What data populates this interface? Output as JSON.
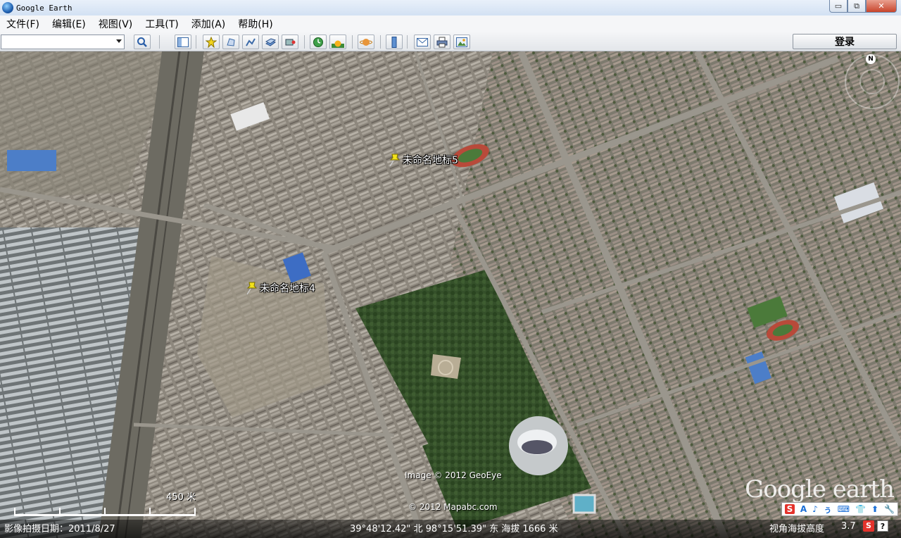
{
  "window": {
    "title": "Google Earth",
    "minimize_glyph": "▭",
    "restore_glyph": "⧉",
    "close_glyph": "✕"
  },
  "menu": {
    "items": [
      {
        "label": "文件(F)"
      },
      {
        "label": "编辑(E)"
      },
      {
        "label": "视图(V)"
      },
      {
        "label": "工具(T)"
      },
      {
        "label": "添加(A)"
      },
      {
        "label": "帮助(H)"
      }
    ]
  },
  "toolbar": {
    "search_value": "",
    "login_label": "登录",
    "buttons": [
      {
        "name": "search-button",
        "icon": "magnifier-icon"
      },
      {
        "name": "sidebar-toggle-button",
        "icon": "sidebar-icon"
      },
      {
        "name": "add-placemark-button",
        "icon": "pushpin-icon"
      },
      {
        "name": "add-polygon-button",
        "icon": "polygon-icon"
      },
      {
        "name": "add-path-button",
        "icon": "path-icon"
      },
      {
        "name": "add-image-overlay-button",
        "icon": "overlay-icon"
      },
      {
        "name": "record-tour-button",
        "icon": "record-tour-icon"
      },
      {
        "name": "historical-imagery-button",
        "icon": "clock-icon"
      },
      {
        "name": "sunlight-button",
        "icon": "sun-icon"
      },
      {
        "name": "switch-planet-button",
        "icon": "planet-icon"
      },
      {
        "name": "ruler-button",
        "icon": "ruler-icon"
      },
      {
        "name": "email-button",
        "icon": "email-icon"
      },
      {
        "name": "print-button",
        "icon": "print-icon"
      },
      {
        "name": "save-image-button",
        "icon": "image-icon"
      }
    ]
  },
  "map": {
    "placemarks": [
      {
        "label": "未命名地标5"
      },
      {
        "label": "未命名地标4"
      }
    ],
    "compass_north": "N",
    "scale_label": "450 米",
    "credit_imagery": "Image © 2012 GeoEye",
    "credit_mapabc": "© 2012 Mapabc.com",
    "logo": "Google earth",
    "ime": {
      "s": "S",
      "a": "A",
      "items": [
        "A",
        "♪",
        "ぅ",
        "⌨",
        "👕",
        "⬆",
        "🔧"
      ]
    }
  },
  "statusbar": {
    "imagery_date": "影像拍摄日期：2011/8/27",
    "coords": "39°48'12.42\" 北  98°15'51.39\" 东  海拔  1666 米",
    "eye_alt": "视角海拔高度",
    "eye_alt_value": "3.7",
    "help": "?"
  }
}
